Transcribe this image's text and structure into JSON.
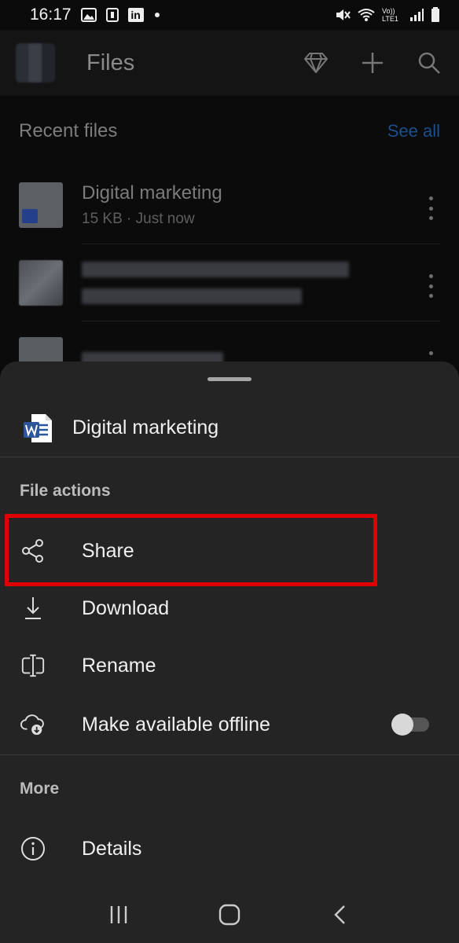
{
  "status_bar": {
    "time": "16:17",
    "left_icons": [
      "image-icon",
      "nfc-icon",
      "linkedin-icon",
      "dot-icon"
    ],
    "right_icons": [
      "mute-icon",
      "wifi-icon",
      "volte-icon",
      "signal-icon",
      "battery-icon"
    ],
    "volte_text": "Vo)) LTE1",
    "linkedin_text": "in"
  },
  "app": {
    "title": "Files",
    "header_icons": [
      "premium-diamond-icon",
      "add-icon",
      "search-icon"
    ],
    "recent": {
      "title": "Recent files",
      "see_all": "See all",
      "files": [
        {
          "name": "Digital marketing",
          "meta": "15 KB · Just now"
        },
        {
          "name": "",
          "meta": ""
        },
        {
          "name": "",
          "meta": ""
        }
      ]
    }
  },
  "sheet": {
    "file_name": "Digital marketing",
    "file_actions_label": "File actions",
    "actions": [
      {
        "label": "Share",
        "icon": "share-icon"
      },
      {
        "label": "Download",
        "icon": "download-icon"
      },
      {
        "label": "Rename",
        "icon": "rename-icon"
      },
      {
        "label": "Make available offline",
        "icon": "cloud-offline-icon",
        "toggle_on": false
      }
    ],
    "more_label": "More",
    "more_actions": [
      {
        "label": "Details",
        "icon": "info-icon"
      }
    ]
  },
  "nav": {
    "icons": [
      "recents-icon",
      "home-icon",
      "back-icon"
    ]
  },
  "colors": {
    "sheet_bg": "#242424",
    "highlight": "#e00000",
    "see_all": "#1c4f8a",
    "word_blue": "#2b579a"
  }
}
